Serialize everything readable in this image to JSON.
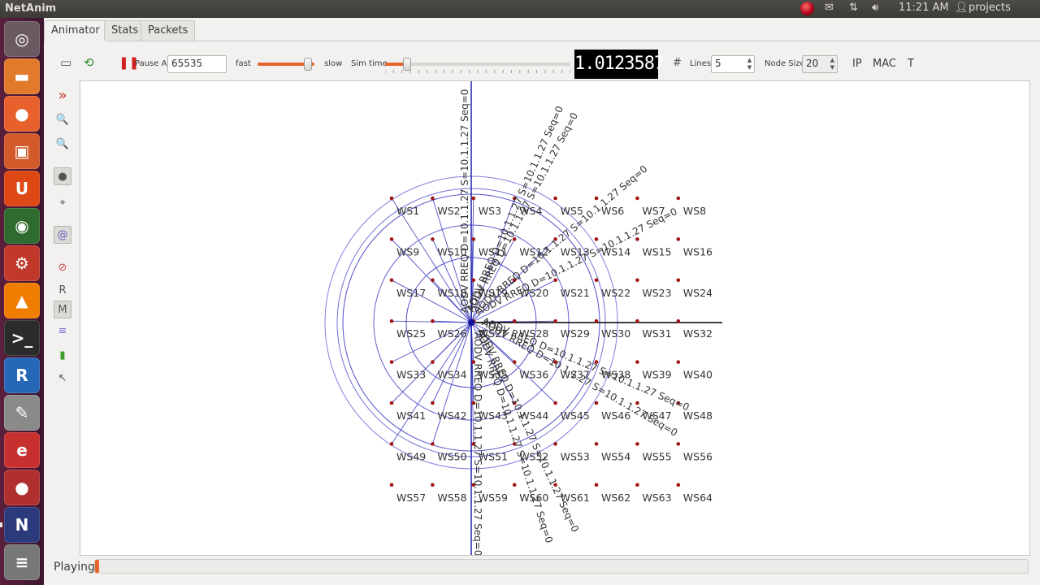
{
  "top_panel": {
    "app_title": "NetAnim",
    "time": "11:21 AM",
    "user": "projects"
  },
  "launcher": {
    "items": [
      {
        "name": "dash-home",
        "glyph": "◎",
        "color": "#6b5a62"
      },
      {
        "name": "files",
        "glyph": "▬",
        "color": "#e17b2b"
      },
      {
        "name": "firefox",
        "glyph": "●",
        "color": "#e8602c"
      },
      {
        "name": "software-center",
        "glyph": "▣",
        "color": "#d35a2a"
      },
      {
        "name": "ubuntu-one",
        "glyph": "U",
        "color": "#dd4814"
      },
      {
        "name": "globe",
        "glyph": "◉",
        "color": "#2f6b2f"
      },
      {
        "name": "system-settings",
        "glyph": "⚙",
        "color": "#c0392b"
      },
      {
        "name": "vlc",
        "glyph": "▲",
        "color": "#f07d00"
      },
      {
        "name": "terminal",
        "glyph": ">_",
        "color": "#2b2b2b"
      },
      {
        "name": "r-language",
        "glyph": "R",
        "color": "#2767b8"
      },
      {
        "name": "text-editor",
        "glyph": "✎",
        "color": "#8a8a8a"
      },
      {
        "name": "eraser",
        "glyph": "e",
        "color": "#c8302f"
      },
      {
        "name": "wine",
        "glyph": "●",
        "color": "#b0302f"
      },
      {
        "name": "netanim",
        "glyph": "N",
        "color": "#2a3a7a"
      },
      {
        "name": "trash",
        "glyph": "≡",
        "color": "#777777"
      }
    ]
  },
  "tabs": [
    {
      "label": "Animator",
      "active": true
    },
    {
      "label": "Stats",
      "active": false
    },
    {
      "label": "Packets",
      "active": false
    }
  ],
  "toolbar": {
    "pause_at_label": "Pause At",
    "pause_at_value": "65535",
    "fast_label": "fast",
    "slow_label": "slow",
    "speed_fraction": 0.88,
    "sim_time_label": "Sim time",
    "sim_time_fraction": 0.12,
    "lcd_value": "1.0123587",
    "lines_label": "Lines",
    "lines_value": "5",
    "node_size_label": "Node Size",
    "node_size_value": "20",
    "ip_label": "IP",
    "mac_label": "MAC",
    "t_label": "T"
  },
  "left_tools": [
    {
      "name": "expand-icon",
      "glyph": "»"
    },
    {
      "name": "zoom-in-icon",
      "glyph": "🔍"
    },
    {
      "name": "zoom-out-icon",
      "glyph": "🔍"
    },
    {
      "name": "node-position-icon",
      "glyph": "●"
    },
    {
      "name": "position-label-icon",
      "glyph": "⌖"
    },
    {
      "name": "fingerprint-icon",
      "glyph": "@"
    },
    {
      "name": "blocked-icon",
      "glyph": "⊘"
    },
    {
      "name": "r-button-icon",
      "glyph": "R"
    },
    {
      "name": "m-button-icon",
      "glyph": "M"
    },
    {
      "name": "lines-icon",
      "glyph": "≡"
    },
    {
      "name": "battery-icon",
      "glyph": "▮"
    },
    {
      "name": "cursor-icon",
      "glyph": "↖"
    }
  ],
  "network": {
    "node_labels": [
      "WS1",
      "WS2",
      "WS3",
      "WS4",
      "WS5",
      "WS6",
      "WS7",
      "WS8",
      "WS9",
      "WS10",
      "WS11",
      "WS12",
      "WS13",
      "WS14",
      "WS15",
      "WS16",
      "WS17",
      "WS18",
      "WS19",
      "WS20",
      "WS21",
      "WS22",
      "WS23",
      "WS24",
      "WS25",
      "WS26",
      "WS27",
      "WS28",
      "WS29",
      "WS30",
      "WS31",
      "WS32",
      "WS33",
      "WS34",
      "WS35",
      "WS36",
      "WS37",
      "WS38",
      "WS39",
      "WS40",
      "WS41",
      "WS42",
      "WS43",
      "WS44",
      "WS45",
      "WS46",
      "WS47",
      "WS48",
      "WS49",
      "WS50",
      "WS51",
      "WS52",
      "WS53",
      "WS54",
      "WS55",
      "WS56",
      "WS57",
      "WS58",
      "WS59",
      "WS60",
      "WS61",
      "WS62",
      "WS63",
      "WS64"
    ],
    "packet_labels": [
      "AODV RREQ D=10.1.1.27 S=10.1.1.27 Seq=0",
      "AODV RREQ D=10.1.1.27 S=10.1.1.27 Seq=0",
      "AODV RREQ D=10.1.1.27 S=10.1.1.27 Seq=0",
      "AODV RREQ D=10.1.1.27 S=10.1.1.27 Seq=0",
      "AODV RREQ D=10.1.1.27 S=10.1.1.27 Seq=0",
      "AODV RREQ D=10.1.1.27 S=10.1.1.27 Seq=0",
      "AODV RREQ D=10.1.1.27 S=10.1.1.27 Seq=0",
      "AODV RREQ D=10.1.1.27 S=10.1.1.27 Seq=0",
      "AODV RREQ D=10.1.1.27 S=10.1.1.27 Seq=0",
      "AODV RREQ D=10.1.1.27 S=10.1.1.27 Seq=0"
    ],
    "colors": {
      "node": "#a01414",
      "link": "#5050c8",
      "center": "#1010a0"
    }
  },
  "status": {
    "label": "Playing",
    "progress": 0.004
  }
}
